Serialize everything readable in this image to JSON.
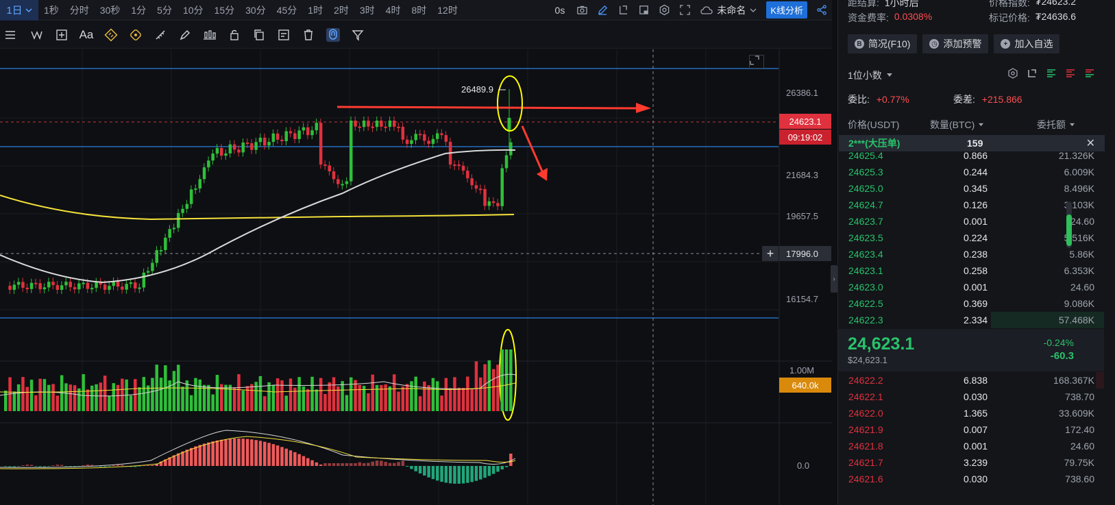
{
  "topbar": {
    "selected": "1日",
    "timeframes": [
      "1秒",
      "分时",
      "30秒",
      "1分",
      "5分",
      "10分",
      "15分",
      "30分",
      "45分",
      "1时",
      "2时",
      "3时",
      "4时",
      "8时",
      "12时"
    ],
    "countdown": "0s",
    "layout_name": "未命名",
    "kline_button": "K线分析"
  },
  "toolbar": {
    "text_tool": "Aa"
  },
  "chart": {
    "axis_labels": [
      "26386.1",
      "21684.3",
      "19657.5",
      "16154.7"
    ],
    "current_price_tag": "24623.1",
    "countdown_tag": "09:19:02",
    "crosshair_price": "17996.0",
    "high_label": "26489.9",
    "volume_axis_label": "1.00M",
    "volume_tag": "640.0k",
    "macd_axis_label": "0.0",
    "colors": {
      "up": "#2fbf3a",
      "down": "#e0313e",
      "ma_yellow": "#f5e23a",
      "ma_white": "#d9d9d9",
      "hline": "#2a7fe0",
      "annotation": "#ff3b30",
      "marker": "#ffff00"
    }
  },
  "panel": {
    "stat1_label": "距结算:",
    "stat1_value": "1小时后",
    "stat1b_label": "价格指数:",
    "stat1b_value": "₮24623.2",
    "stat2_label": "资金费率:",
    "stat2_value": "0.0308%",
    "stat2b_label": "标记价格:",
    "stat2b_value": "₮24636.6",
    "buttons": {
      "overview": "简况(F10)",
      "alert": "添加预警",
      "watch": "加入自选"
    },
    "decimals": "1位小数",
    "ratio_label": "委比:",
    "ratio_value": "+0.77%",
    "diff_label": "委差:",
    "diff_value": "+215.866",
    "col_price": "价格(USDT)",
    "col_qty": "数量(BTC)",
    "col_total": "委托额",
    "big_order_name": "2***(大压单)",
    "big_order_qty": "159",
    "asks": [
      {
        "p": "24625.4",
        "q": "0.866",
        "t": "21.326K"
      },
      {
        "p": "24625.3",
        "q": "0.244",
        "t": "6.009K"
      },
      {
        "p": "24625.0",
        "q": "0.345",
        "t": "8.496K"
      },
      {
        "p": "24624.7",
        "q": "0.126",
        "t": "3.103K"
      },
      {
        "p": "24623.7",
        "q": "0.001",
        "t": "24.60"
      },
      {
        "p": "24623.5",
        "q": "0.224",
        "t": "5.516K"
      },
      {
        "p": "24623.4",
        "q": "0.238",
        "t": "5.86K"
      },
      {
        "p": "24623.1",
        "q": "0.258",
        "t": "6.353K"
      },
      {
        "p": "24623.0",
        "q": "0.001",
        "t": "24.60"
      },
      {
        "p": "24622.5",
        "q": "0.369",
        "t": "9.086K"
      },
      {
        "p": "24622.3",
        "q": "2.334",
        "t": "57.468K"
      }
    ],
    "last_price": "24,623.1",
    "last_price_usd": "$24,623.1",
    "change_pct": "-0.24%",
    "change_abs": "-60.3",
    "bids": [
      {
        "p": "24622.2",
        "q": "6.838",
        "t": "168.367K"
      },
      {
        "p": "24622.1",
        "q": "0.030",
        "t": "738.70"
      },
      {
        "p": "24622.0",
        "q": "1.365",
        "t": "33.609K"
      },
      {
        "p": "24621.9",
        "q": "0.007",
        "t": "172.40"
      },
      {
        "p": "24621.8",
        "q": "0.001",
        "t": "24.60"
      },
      {
        "p": "24621.7",
        "q": "3.239",
        "t": "79.75K"
      },
      {
        "p": "24621.6",
        "q": "0.030",
        "t": "738.60"
      }
    ]
  }
}
